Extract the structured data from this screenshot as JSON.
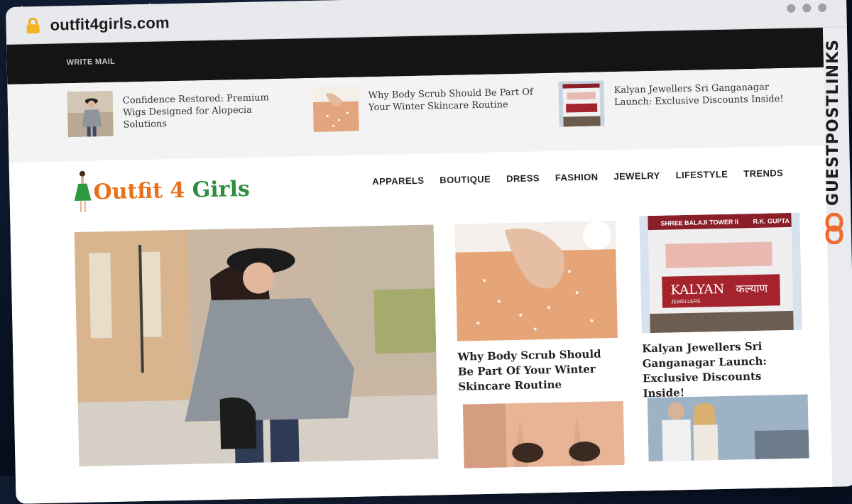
{
  "browser": {
    "url": "outfit4girls.com",
    "side_badge": "GUESTPOSTLINKS"
  },
  "topbar": {
    "link": "WRITE MAIL"
  },
  "ticker": [
    {
      "title": "Confidence Restored: Premium Wigs Designed for Alopecia Solutions"
    },
    {
      "title": "Why Body Scrub Should Be Part Of Your Winter Skincare Routine"
    },
    {
      "title": "Kalyan Jewellers Sri Ganganagar Launch: Exclusive Discounts Inside!"
    }
  ],
  "logo": {
    "part1": "Outfit 4 ",
    "part2": "Girls"
  },
  "nav": [
    "APPARELS",
    "BOUTIQUE",
    "DRESS",
    "FASHION",
    "JEWELRY",
    "LIFESTYLE",
    "TRENDS"
  ],
  "cards": [
    {
      "title": "Why Body Scrub Should Be Part Of Your Winter Skincare Routine"
    },
    {
      "title": "Kalyan Jewellers Sri Ganganagar Launch: Exclusive Discounts Inside!"
    }
  ],
  "store_signs": {
    "top": "SHREE BALAJI TOWER II",
    "owner": "R.K. GUPTA",
    "brand": "KALYAN",
    "brand_sub": "JEWELLERS",
    "brand_hindi": "कल्याण"
  },
  "colors": {
    "accent_orange": "#e8701a",
    "accent_green": "#2f8f3f",
    "topbar": "#141414"
  }
}
